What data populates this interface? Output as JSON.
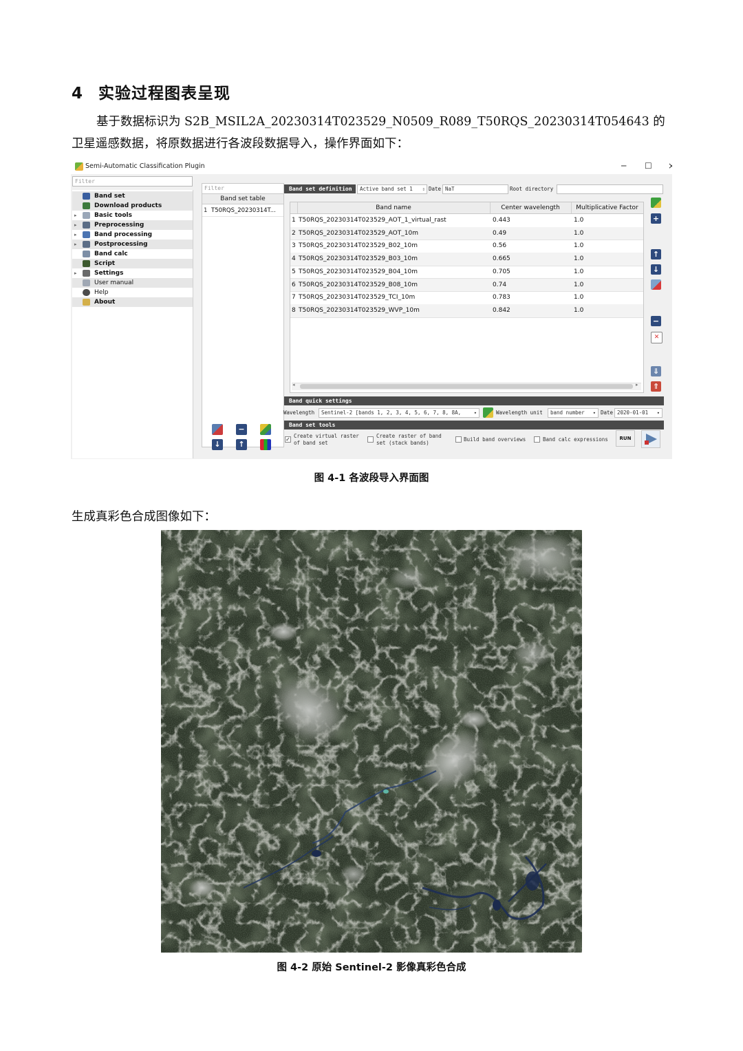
{
  "heading": {
    "number": "4",
    "text": "实验过程图表呈现"
  },
  "paragraph1": "基于数据标识为 S2B_MSIL2A_20230314T023529_N0509_R089_T50RQS_20230314T054643 的卫星遥感数据，将原数据进行各波段数据导入，操作界面如下：",
  "caption1": "图 4-1  各波段导入界面图",
  "paragraph2": "生成真彩色合成图像如下：",
  "caption2": "图 4-2  原始 Sentinel-2 影像真彩色合成",
  "window": {
    "title": "Semi-Automatic Classification Plugin",
    "controls": {
      "minimize": "─",
      "maximize": "☐",
      "close": "×"
    },
    "filter_placeholder": "Filter",
    "nav": [
      {
        "label": "Band set",
        "icon": "band-set-icon"
      },
      {
        "label": "Download products",
        "icon": "download-icon"
      },
      {
        "label": "Basic tools",
        "icon": "basic-tools-icon"
      },
      {
        "label": "Preprocessing",
        "icon": "preprocessing-icon"
      },
      {
        "label": "Band processing",
        "icon": "band-processing-icon"
      },
      {
        "label": "Postprocessing",
        "icon": "postprocessing-icon"
      },
      {
        "label": "Band calc",
        "icon": "band-calc-icon"
      },
      {
        "label": "Script",
        "icon": "script-icon"
      },
      {
        "label": "Settings",
        "icon": "settings-icon"
      },
      {
        "label": "User manual",
        "icon": "manual-icon"
      },
      {
        "label": "Help",
        "icon": "help-icon"
      },
      {
        "label": "About",
        "icon": "about-icon"
      }
    ],
    "band_set_table": {
      "filter_placeholder": "Filter",
      "header": "Band set table",
      "rows": [
        {
          "index": "1",
          "name": "T50RQS_20230314T..."
        }
      ]
    },
    "band_set_definition": {
      "label": "Band set definition",
      "active_band_set": "Active band set",
      "active_band_set_value": "1",
      "date_label": "Date",
      "date_value": "NaT",
      "root_directory_label": "Root directory",
      "root_directory_value": ""
    },
    "band_table": {
      "columns": [
        "Band name",
        "Center wavelength",
        "Multiplicative Factor"
      ],
      "rows": [
        {
          "index": "1",
          "name": "T50RQS_20230314T023529_AOT_1_virtual_rast",
          "wavelength": "0.443",
          "factor": "1.0"
        },
        {
          "index": "2",
          "name": "T50RQS_20230314T023529_AOT_10m",
          "wavelength": "0.49",
          "factor": "1.0"
        },
        {
          "index": "3",
          "name": "T50RQS_20230314T023529_B02_10m",
          "wavelength": "0.56",
          "factor": "1.0"
        },
        {
          "index": "4",
          "name": "T50RQS_20230314T023529_B03_10m",
          "wavelength": "0.665",
          "factor": "1.0"
        },
        {
          "index": "5",
          "name": "T50RQS_20230314T023529_B04_10m",
          "wavelength": "0.705",
          "factor": "1.0"
        },
        {
          "index": "6",
          "name": "T50RQS_20230314T023529_B08_10m",
          "wavelength": "0.74",
          "factor": "1.0"
        },
        {
          "index": "7",
          "name": "T50RQS_20230314T023529_TCI_10m",
          "wavelength": "0.783",
          "factor": "1.0"
        },
        {
          "index": "8",
          "name": "T50RQS_20230314T023529_WVP_10m",
          "wavelength": "0.842",
          "factor": "1.0"
        }
      ]
    },
    "band_quick_settings": {
      "label": "Band quick settings",
      "wavelength_label": "Wavelength",
      "wavelength_value": "Sentinel-2 [bands 1, 2, 3, 4, 5, 6, 7, 8, 8A,",
      "wavelength_unit_label": "Wavelength unit",
      "wavelength_unit_value": "band number",
      "date_label": "Date",
      "date_value": "2020-01-01"
    },
    "band_set_tools": {
      "label": "Band set tools",
      "create_virtual_raster": "Create virtual raster of band set",
      "create_raster": "Create raster of band set (stack bands)",
      "build_overviews": "Build band overviews",
      "band_calc_expressions": "Band calc expressions",
      "run_label": "RUN"
    }
  },
  "colors": {
    "dark_bar": "#4a4a4a",
    "navy_button": "#2e4a7d",
    "alt_row": "#f3f3f3"
  }
}
